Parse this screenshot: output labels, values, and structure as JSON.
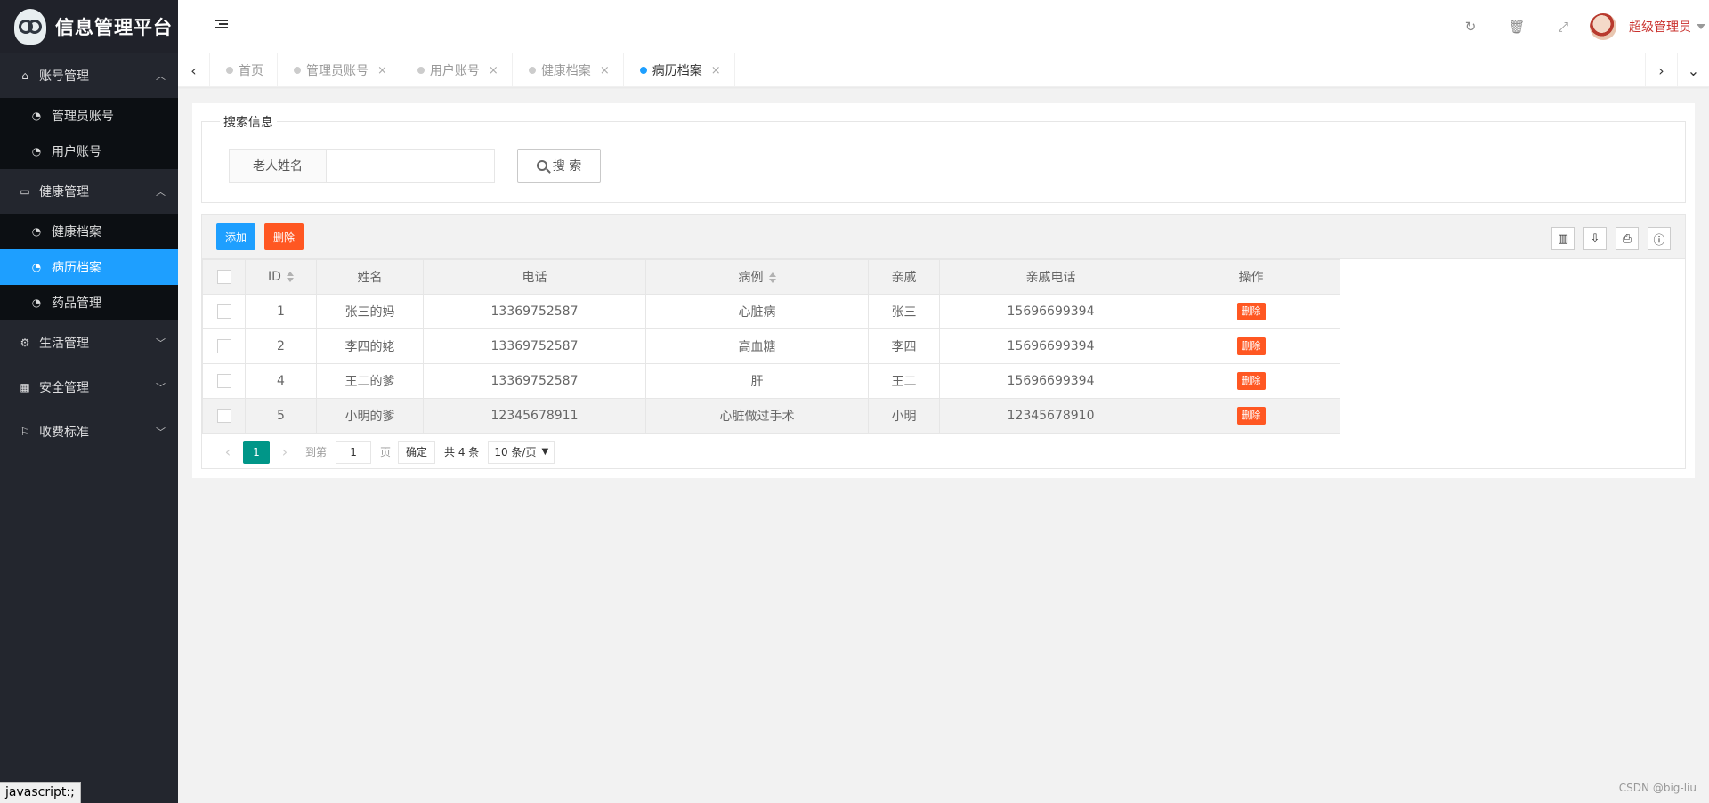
{
  "app": {
    "title": "信息管理平台"
  },
  "sidebar": {
    "groups": [
      {
        "label": "账号管理",
        "icon": "home-icon",
        "expanded": true,
        "items": [
          {
            "label": "管理员账号",
            "active": false
          },
          {
            "label": "用户账号",
            "active": false
          }
        ]
      },
      {
        "label": "健康管理",
        "icon": "window-icon",
        "expanded": true,
        "items": [
          {
            "label": "健康档案",
            "active": false
          },
          {
            "label": "病历档案",
            "active": true
          },
          {
            "label": "药品管理",
            "active": false
          }
        ]
      },
      {
        "label": "生活管理",
        "icon": "gears-icon",
        "expanded": false,
        "items": []
      },
      {
        "label": "安全管理",
        "icon": "calendar-icon",
        "expanded": false,
        "items": []
      },
      {
        "label": "收费标准",
        "icon": "flag-icon",
        "expanded": false,
        "items": []
      }
    ]
  },
  "header": {
    "user": "超级管理员"
  },
  "tabs": [
    {
      "label": "首页",
      "closable": false,
      "active": false
    },
    {
      "label": "管理员账号",
      "closable": true,
      "active": false
    },
    {
      "label": "用户账号",
      "closable": true,
      "active": false
    },
    {
      "label": "健康档案",
      "closable": true,
      "active": false
    },
    {
      "label": "病历档案",
      "closable": true,
      "active": true
    }
  ],
  "search": {
    "legend": "搜索信息",
    "field_label": "老人姓名",
    "field_value": "",
    "button": "搜 索"
  },
  "toolbar": {
    "add": "添加",
    "delete": "删除"
  },
  "table": {
    "columns": [
      "ID",
      "姓名",
      "电话",
      "病例",
      "亲戚",
      "亲戚电话",
      "操作"
    ],
    "rows": [
      {
        "id": "1",
        "name": "张三的妈",
        "phone": "13369752587",
        "case": "心脏病",
        "relative": "张三",
        "relative_phone": "15696699394",
        "action": "删除"
      },
      {
        "id": "2",
        "name": "李四的姥",
        "phone": "13369752587",
        "case": "高血糖",
        "relative": "李四",
        "relative_phone": "15696699394",
        "action": "删除"
      },
      {
        "id": "4",
        "name": "王二的爹",
        "phone": "13369752587",
        "case": "肝",
        "relative": "王二",
        "relative_phone": "15696699394",
        "action": "删除"
      },
      {
        "id": "5",
        "name": "小明的爹",
        "phone": "12345678911",
        "case": "心脏做过手术",
        "relative": "小明",
        "relative_phone": "12345678910",
        "action": "删除"
      }
    ]
  },
  "pager": {
    "current": "1",
    "goto_label": "到第",
    "goto_value": "1",
    "page_unit": "页",
    "confirm": "确定",
    "total": "共 4 条",
    "page_size": "10 条/页"
  },
  "status_tip": "javascript:;",
  "watermark": "CSDN @big-liu"
}
